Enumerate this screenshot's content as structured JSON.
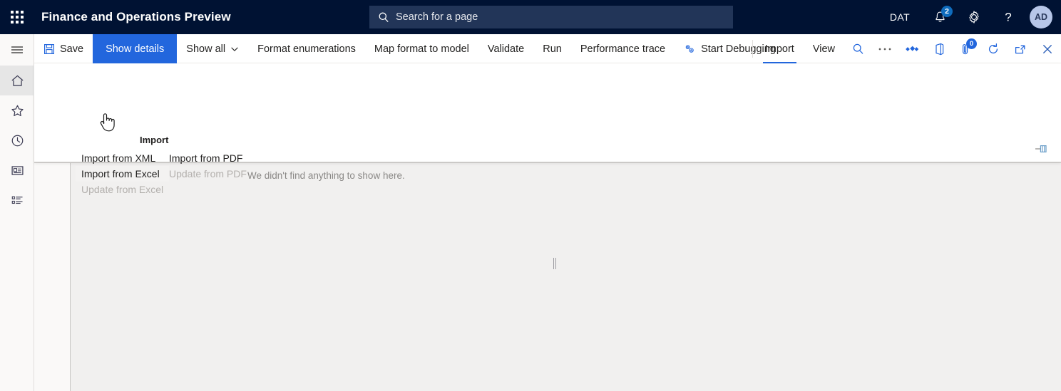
{
  "topbar": {
    "waffle_icon": "app-grid-icon",
    "brand": "Finance and Operations Preview",
    "search": {
      "icon": "search-icon",
      "placeholder": "Search for a page",
      "value": "Search for a page"
    },
    "company": "DAT",
    "notifications": {
      "icon": "bell-icon",
      "count": "2"
    },
    "settings_icon": "gear-icon",
    "help_icon": "help-icon",
    "avatar": {
      "icon": "avatar",
      "initials": "AD"
    },
    "bg_color": "#001233",
    "badge_color": "#0f6cbd"
  },
  "rail": {
    "items": [
      {
        "name": "hamburger-menu",
        "icon": "hamburger-icon",
        "label": "Expand the navigation pane"
      },
      {
        "name": "home",
        "icon": "home-icon",
        "label": "Home",
        "active": true
      },
      {
        "name": "favorites",
        "icon": "star-icon",
        "label": "Favorites"
      },
      {
        "name": "recent",
        "icon": "clock-icon",
        "label": "Recent"
      },
      {
        "name": "workspaces",
        "icon": "workspace-icon",
        "label": "Workspaces"
      },
      {
        "name": "modules",
        "icon": "list-icon",
        "label": "Modules"
      }
    ]
  },
  "commandbar": {
    "save": {
      "label": "Save",
      "icon": "save-icon"
    },
    "show_details": {
      "label": "Show details"
    },
    "show_all": {
      "label": "Show all",
      "icon": "chevron-down-icon"
    },
    "format_enumerations": {
      "label": "Format enumerations"
    },
    "map_format_to_model": {
      "label": "Map format to model"
    },
    "validate": {
      "label": "Validate"
    },
    "run": {
      "label": "Run"
    },
    "performance_trace": {
      "label": "Performance trace"
    },
    "start_debugging": {
      "label": "Start Debugging",
      "icon": "gears-icon"
    },
    "import_tab": {
      "label": "Import",
      "active": true
    },
    "view_tab": {
      "label": "View"
    },
    "search_icon": "search-icon",
    "overflow": {
      "label": "...",
      "icon": "ellipsis-icon"
    },
    "office_icons": {
      "attach_icon": "attach-icon",
      "attach_count": "0",
      "refresh_icon": "refresh-icon",
      "popout_icon": "popout-icon",
      "close_icon": "close-icon"
    },
    "accent_color": "#2266dd"
  },
  "dropdown": {
    "title": "Import",
    "col1": [
      {
        "label": "Import from XML",
        "state": "normal"
      },
      {
        "label": "Import from Excel",
        "state": "hover"
      },
      {
        "label": "Update from Excel",
        "state": "disabled"
      }
    ],
    "col2": [
      {
        "label": "Import from PDF",
        "state": "normal"
      },
      {
        "label": "Update from PDF",
        "state": "disabled"
      }
    ],
    "pin_icon": "pin-icon"
  },
  "content": {
    "empty_message": "We didn't find anything to show here.",
    "splitter": "splitter-handle"
  },
  "cursor": {
    "icon": "hand-pointer-cursor"
  }
}
